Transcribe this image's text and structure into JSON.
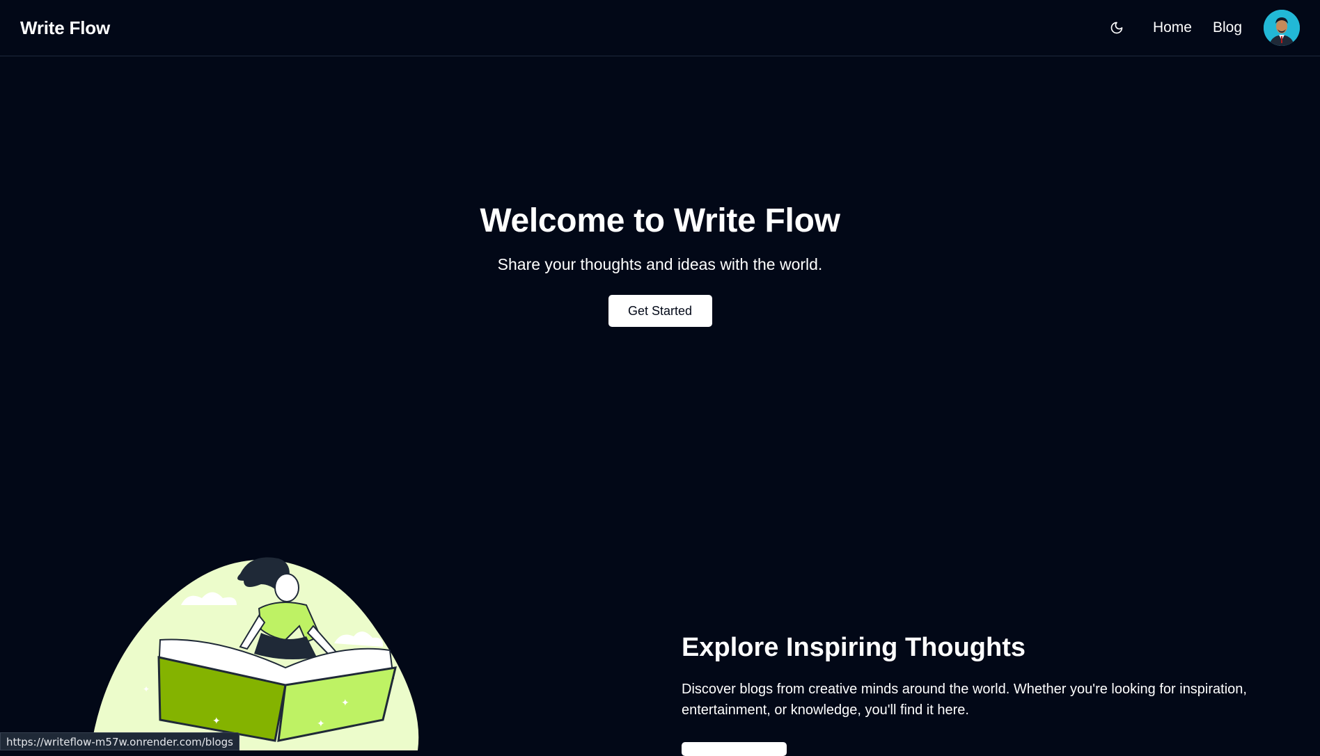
{
  "nav": {
    "brand": "Write Flow",
    "theme_icon": "moon-icon",
    "links": [
      "Home",
      "Blog"
    ],
    "avatar_icon": "user-avatar"
  },
  "hero": {
    "title": "Welcome to Write Flow",
    "subtitle": "Share your thoughts and ideas with the world.",
    "cta_label": "Get Started"
  },
  "explore": {
    "title": "Explore Inspiring Thoughts",
    "text": "Discover blogs from creative minds around the world. Whether you're looking for inspiration, entertainment, or knowledge, you'll find it here."
  },
  "status_bar": {
    "url": "https://writeflow-m57w.onrender.com/blogs"
  },
  "colors": {
    "background": "#020817",
    "accent_lime": "#bef264",
    "illustration_bg": "#ecfccb"
  }
}
